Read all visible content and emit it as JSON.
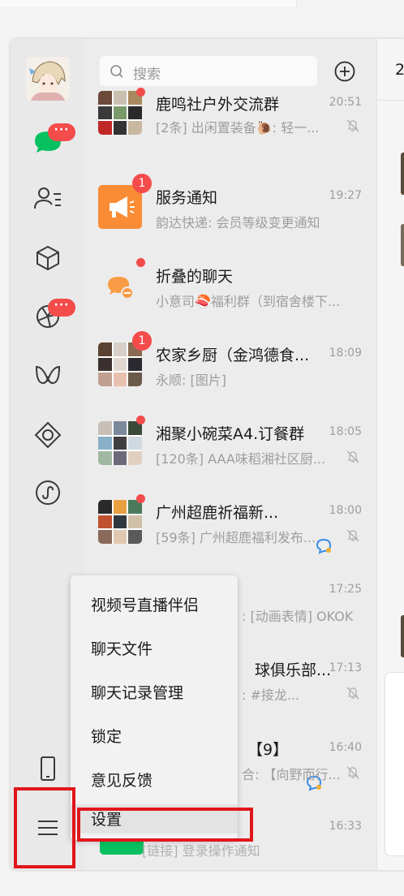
{
  "search": {
    "placeholder": "搜索"
  },
  "right_header_partial": "2",
  "nav": {
    "chat_badge": "···",
    "moments_badge": "···"
  },
  "chats": [
    {
      "name": "鹿鸣社户外交流群",
      "time": "20:51",
      "preview": "[2条] 出闲置装备🐌: 轻一...",
      "muted": true,
      "badge": "dot"
    },
    {
      "name": "服务通知",
      "time": "19:27",
      "preview": "韵达快递: 会员等级变更通知",
      "muted": false,
      "badge": "1"
    },
    {
      "name": "折叠的聊天",
      "time": "",
      "preview": "小意司🍣福利群（到宿舍楼下...",
      "muted": false,
      "badge": "dot"
    },
    {
      "name": "农家乡厨（金鸿德食...",
      "time": "18:09",
      "preview": "永顺: [图片]",
      "muted": false,
      "badge": "1"
    },
    {
      "name": "湘聚小碗菜A4.订餐群",
      "time": "18:05",
      "preview": "[120条] AAA味稻湘社区厨...",
      "muted": true,
      "badge": "dot"
    },
    {
      "name": "广州超鹿祈福新...",
      "time": "18:00",
      "preview": "[59条] 广州超鹿福利发布...",
      "muted": true,
      "badge": "dot"
    },
    {
      "name": "",
      "time": "17:25",
      "preview": ": [动画表情] OKOK",
      "muted": false,
      "badge": ""
    },
    {
      "name": "球俱乐部...",
      "time": "17:13",
      "preview": ": #接龙...",
      "muted": true,
      "badge": ""
    },
    {
      "name": "【9】",
      "time": "16:40",
      "preview": "合: 【向野而行...",
      "muted": true,
      "badge": ""
    },
    {
      "name": "",
      "time": "16:33",
      "preview": "[链接] 登录操作通知",
      "muted": false,
      "badge": ""
    }
  ],
  "menu": {
    "items": [
      "视频号直播伴侣",
      "聊天文件",
      "聊天记录管理",
      "锁定",
      "意见反馈",
      "设置"
    ]
  },
  "colors": {
    "highlight": "#e0161b",
    "badge": "#f44b4b",
    "wechat_green": "#07c160",
    "service_orange": "#fa8c35"
  }
}
